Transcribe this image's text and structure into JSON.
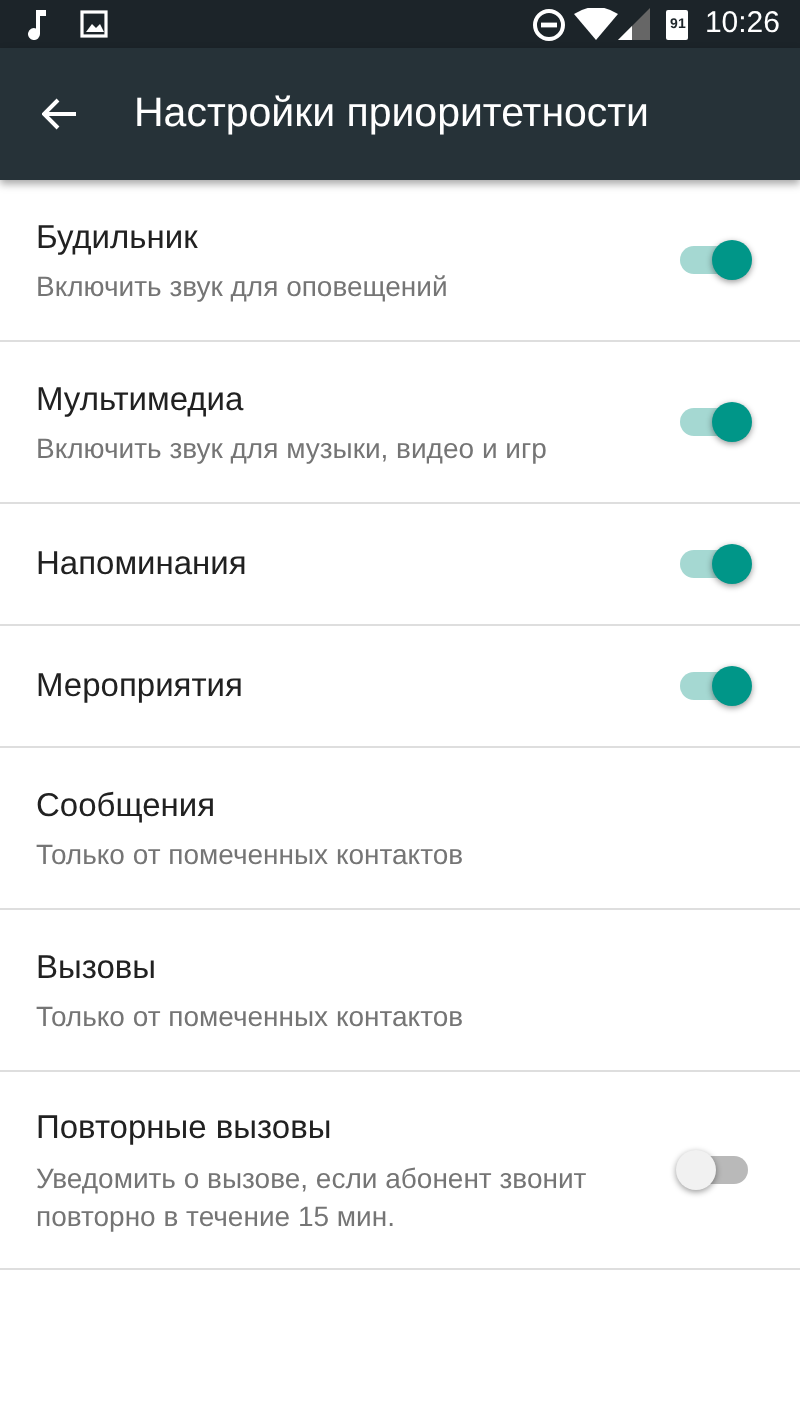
{
  "status_bar": {
    "battery": "91",
    "time": "10:26"
  },
  "toolbar": {
    "title": "Настройки приоритетности"
  },
  "settings": [
    {
      "kind": "switch",
      "title": "Будильник",
      "subtitle": "Включить звук для оповещений",
      "on": true
    },
    {
      "kind": "switch",
      "title": "Мультимедиа",
      "subtitle": "Включить звук для музыки, видео и игр",
      "on": true
    },
    {
      "kind": "switch",
      "title": "Напоминания",
      "on": true
    },
    {
      "kind": "switch",
      "title": "Мероприятия",
      "on": true
    },
    {
      "kind": "plain",
      "title": "Сообщения",
      "subtitle": "Только от помеченных контактов"
    },
    {
      "kind": "plain",
      "title": "Вызовы",
      "subtitle": "Только от помеченных контактов"
    },
    {
      "kind": "switch",
      "title": "Повторные вызовы",
      "subtitle": "Уведомить о вызове, если абонент звонит повторно в течение 15 мин.",
      "on": false
    }
  ]
}
